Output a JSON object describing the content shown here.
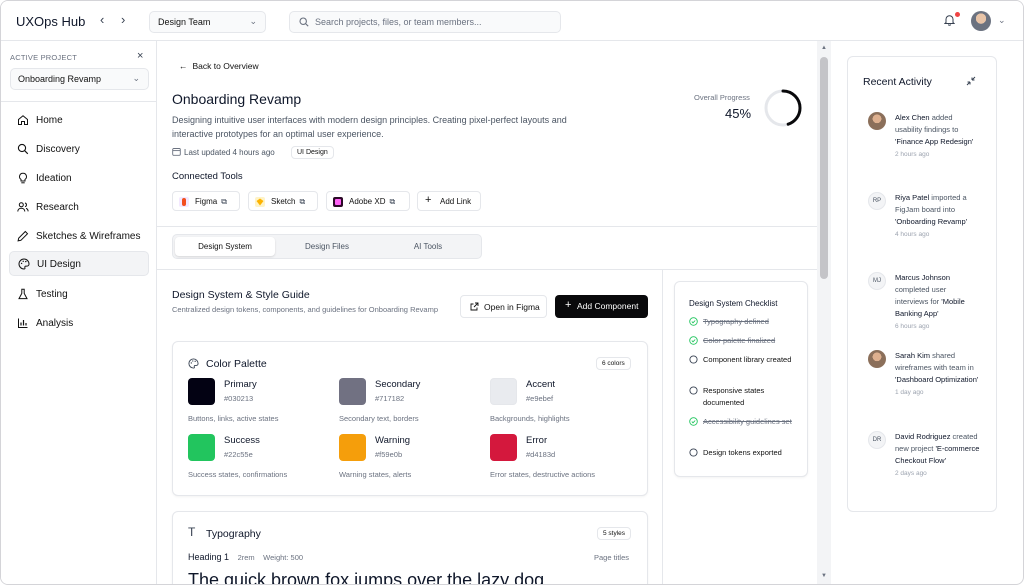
{
  "app": {
    "title": "UXOps Hub",
    "back_arrow": "‹",
    "forward_arrow": "›"
  },
  "topbar": {
    "team": "Design Team",
    "search_placeholder": "Search projects, files, or team members..."
  },
  "sidebar": {
    "project_label": "ACTIVE PROJECT",
    "project_close": "×",
    "project_name": "Onboarding Revamp",
    "items": [
      {
        "label": "Home",
        "icon": "home-icon"
      },
      {
        "label": "Discovery",
        "icon": "search-icon"
      },
      {
        "label": "Ideation",
        "icon": "lightbulb-icon"
      },
      {
        "label": "Research",
        "icon": "users-icon"
      },
      {
        "label": "Sketches & Wireframes",
        "icon": "pencil-icon"
      },
      {
        "label": "UI Design",
        "icon": "palette-icon",
        "active": true
      },
      {
        "label": "Testing",
        "icon": "flask-icon"
      },
      {
        "label": "Analysis",
        "icon": "bar-chart-icon"
      }
    ]
  },
  "main": {
    "back_label": "Back to Overview",
    "title": "Onboarding Revamp",
    "description": "Designing intuitive user interfaces with modern design principles. Creating pixel-perfect layouts and interactive prototypes for an optimal user experience.",
    "last_updated": "Last updated 4 hours ago",
    "phase_badge": "UI Design",
    "progress_label": "Overall Progress",
    "progress_value": "45%",
    "progress_fraction": 0.45,
    "connected_tools_label": "Connected Tools",
    "tools": [
      {
        "label": "Figma",
        "color": "#f24e1e"
      },
      {
        "label": "Sketch",
        "color": "#fdb300"
      },
      {
        "label": "Adobe XD",
        "color": "#470137"
      },
      {
        "label": "Add Link"
      }
    ],
    "tabs": [
      "Design System",
      "Design Files",
      "AI Tools"
    ],
    "active_tab": "Design System",
    "design_system": {
      "title": "Design System & Style Guide",
      "subtitle": "Centralized design tokens, components, and guidelines for Onboarding Revamp",
      "open_figma": "Open in Figma",
      "add_component": "Add Component"
    },
    "color_palette": {
      "title": "Color Palette",
      "count": "6 colors",
      "colors": [
        {
          "name": "Primary",
          "hex": "#030213",
          "use": "Buttons, links, active states"
        },
        {
          "name": "Secondary",
          "hex": "#717182",
          "use": "Secondary text, borders"
        },
        {
          "name": "Accent",
          "hex": "#e9ebef",
          "use": "Backgrounds, highlights"
        },
        {
          "name": "Success",
          "hex": "#22c55e",
          "use": "Success states, confirmations"
        },
        {
          "name": "Warning",
          "hex": "#f59e0b",
          "use": "Warning states, alerts"
        },
        {
          "name": "Error",
          "hex": "#d4183d",
          "use": "Error states, destructive actions"
        }
      ]
    },
    "typography": {
      "title": "Typography",
      "count": "5 styles",
      "heading1": "Heading 1",
      "heading1_size": "2rem",
      "heading1_weight": "Weight: 500",
      "heading1_use": "Page titles",
      "sample": "The quick brown fox jumps over the lazy dog"
    },
    "checklist": {
      "title": "Design System Checklist",
      "items": [
        {
          "label": "Typography defined",
          "done": true
        },
        {
          "label": "Color palette finalized",
          "done": true
        },
        {
          "label": "Component library created",
          "done": false
        },
        {
          "label": "Responsive states documented",
          "done": false
        },
        {
          "label": "Accessibility guidelines set",
          "done": true
        },
        {
          "label": "Design tokens exported",
          "done": false
        }
      ]
    }
  },
  "activity": {
    "title": "Recent Activity",
    "items": [
      {
        "initials": "",
        "name": "Alex Chen",
        "action": "added usability findings to",
        "target": "'Finance App Redesign'",
        "time": "2 hours ago"
      },
      {
        "initials": "RP",
        "name": "Riya Patel",
        "action": "imported a FigJam board into",
        "target": "'Onboarding Revamp'",
        "time": "4 hours ago"
      },
      {
        "initials": "MJ",
        "name": "Marcus Johnson",
        "action": "completed user interviews for",
        "target": "'Mobile Banking App'",
        "time": "6 hours ago"
      },
      {
        "initials": "",
        "name": "Sarah Kim",
        "action": "shared wireframes with team in",
        "target": "'Dashboard Optimization'",
        "time": "1 day ago"
      },
      {
        "initials": "DR",
        "name": "David Rodriguez",
        "action": "created new project",
        "target": "'E-commerce Checkout Flow'",
        "time": "2 days ago"
      }
    ]
  }
}
